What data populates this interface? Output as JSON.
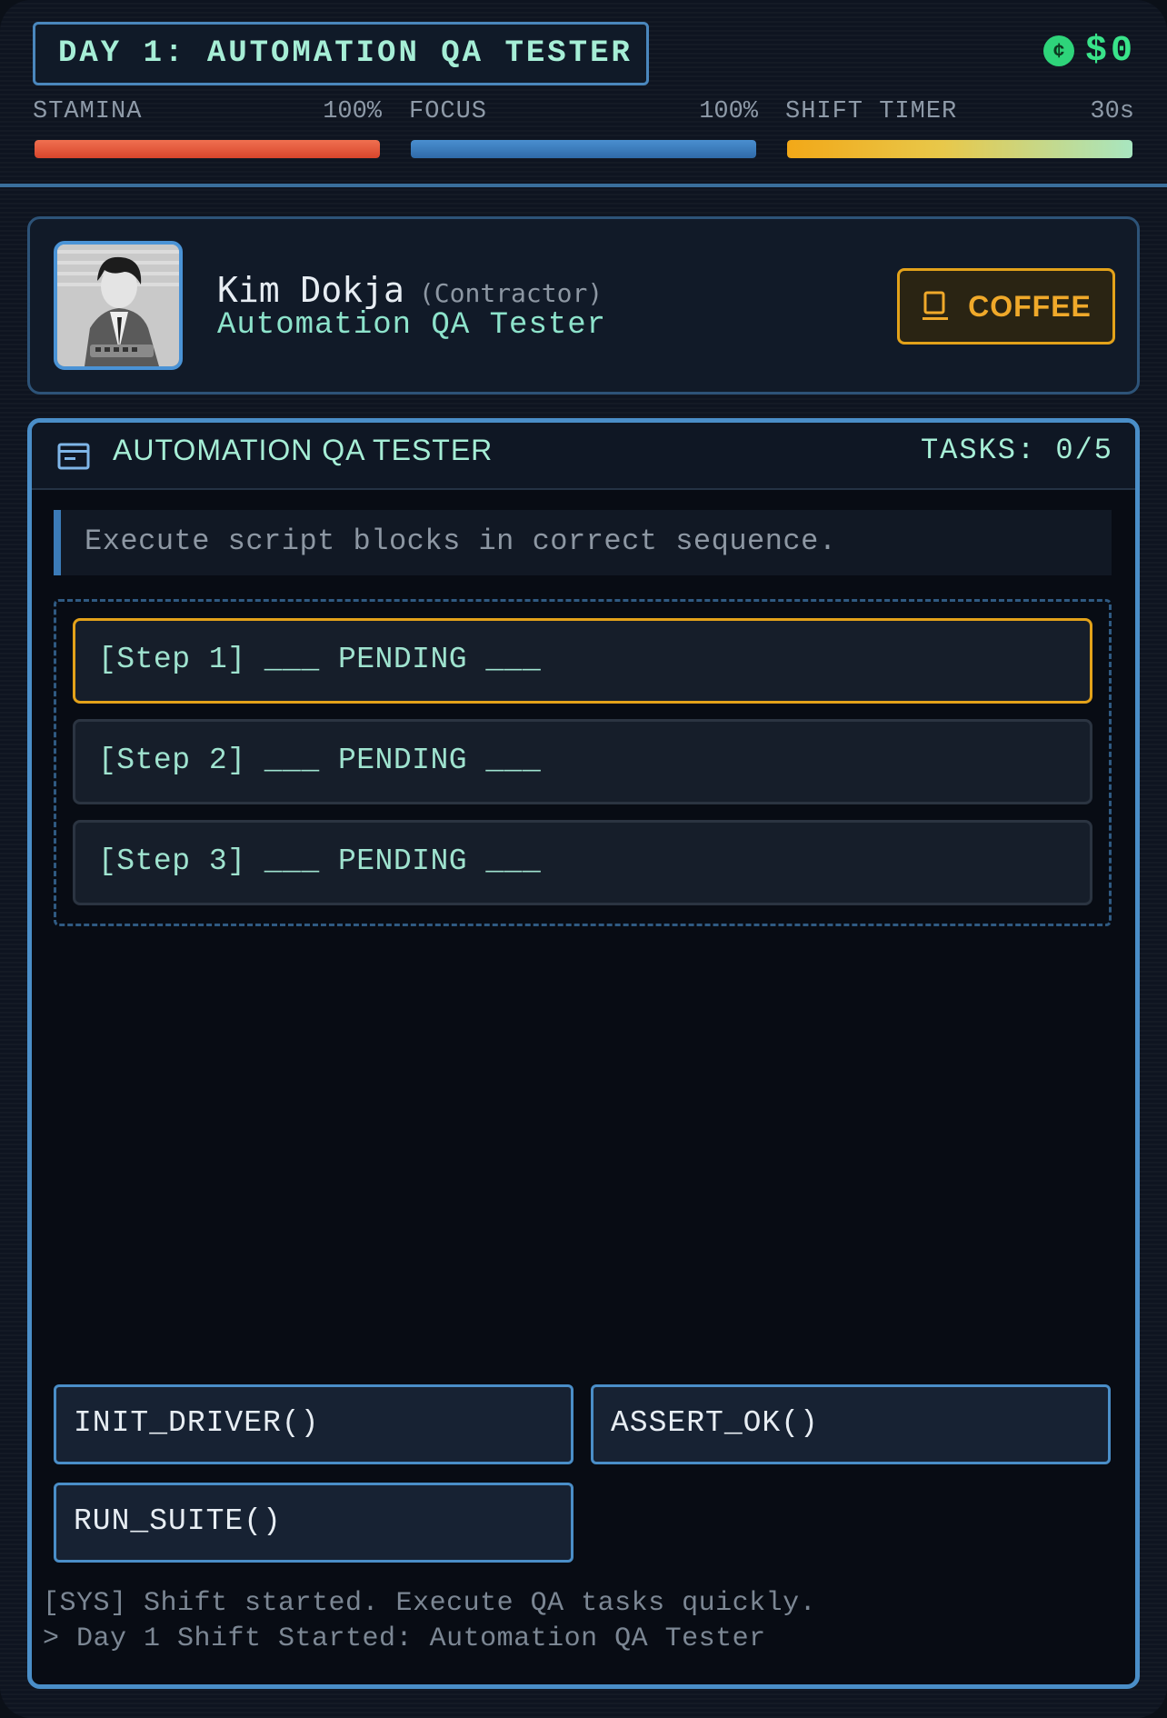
{
  "header": {
    "day_title": "DAY 1: AUTOMATION QA TESTER",
    "currency_symbol": "$",
    "money_value": "0",
    "coin_icon": "coin-icon",
    "meters": {
      "stamina": {
        "label": "STAMINA",
        "value_text": "100%",
        "level": 1.0,
        "color": "#e0553a"
      },
      "focus": {
        "label": "FOCUS",
        "value_text": "100%",
        "level": 1.0,
        "color": "#3a7ec0"
      },
      "timer": {
        "label": "SHIFT TIMER",
        "value_text": "30s",
        "level": 1.0,
        "color": "#f2a818"
      }
    }
  },
  "profile": {
    "name": "Kim Dokja",
    "role_tag": "(Contractor)",
    "job_title": "Automation QA Tester",
    "coffee_label": "COFFEE",
    "coffee_icon": "coffee-cup-icon"
  },
  "panel": {
    "title": "AUTOMATION QA TESTER",
    "tasks": "TASKS: 0/5",
    "icon": "window-icon",
    "instruction": "Execute script blocks in correct sequence.",
    "steps": [
      {
        "label": "[Step 1] ___ PENDING ___",
        "active": true
      },
      {
        "label": "[Step 2] ___ PENDING ___",
        "active": false
      },
      {
        "label": "[Step 3] ___ PENDING ___",
        "active": false
      }
    ],
    "commands": [
      "INIT_DRIVER()",
      "ASSERT_OK()",
      "RUN_SUITE()"
    ],
    "log": [
      "[SYS] Shift started. Execute QA tasks quickly.",
      "> Day 1 Shift Started: Automation QA Tester"
    ]
  },
  "colors": {
    "accent_blue": "#4a8ec8",
    "accent_orange": "#e3a21a",
    "money_green": "#39e38a",
    "text_mint": "#9fe3cf"
  }
}
